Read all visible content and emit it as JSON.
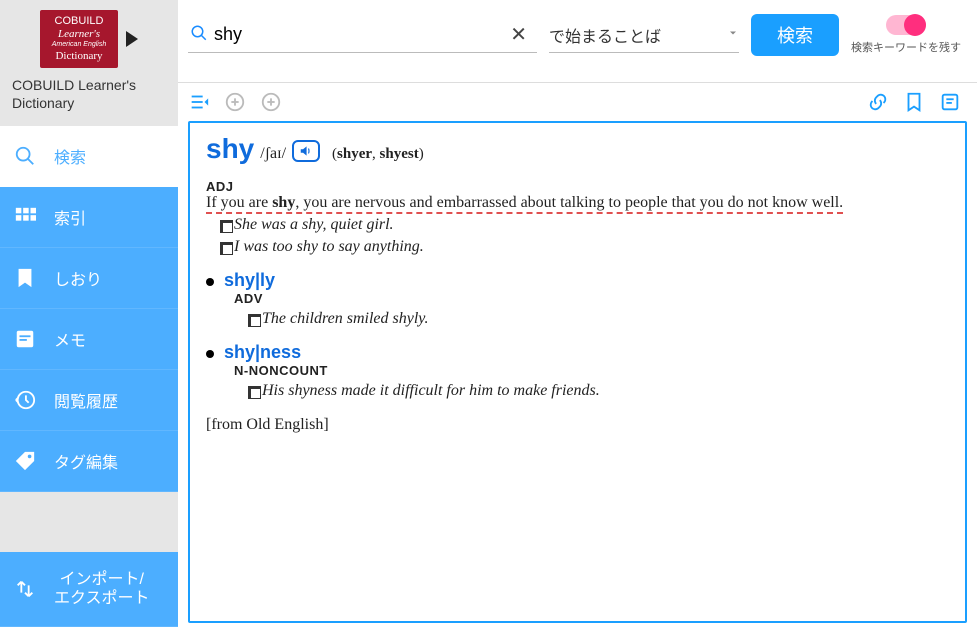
{
  "app": {
    "title_line1": "COBUILD Learner's",
    "title_line2": "Dictionary"
  },
  "logo": {
    "l1": "COBUILD",
    "l2": "Learner's",
    "l3": "American English",
    "l4": "Dictionary"
  },
  "nav": {
    "search": "検索",
    "index": "索引",
    "bookmark": "しおり",
    "memo": "メモ",
    "history": "閲覧履歴",
    "tag": "タグ編集",
    "import_line1": "インポート/",
    "import_line2": "エクスポート"
  },
  "search": {
    "value": "shy",
    "filter": "で始まることば",
    "button": "検索",
    "toggle_label": "検索キーワードを残す"
  },
  "entry": {
    "headword": "shy",
    "ipa": "/ʃaɪ/",
    "forms_open": "(",
    "form1": "shyer",
    "form_sep": ", ",
    "form2": "shyest",
    "forms_close": ")",
    "pos": "ADJ",
    "def_pre": "If you are ",
    "def_bold": "shy",
    "def_post": ", you are nervous and embarrassed about talking to people that you do not know well.",
    "ex1": "She was a shy, quiet girl.",
    "ex2": "I was too shy to say anything.",
    "deriv1": {
      "head": "shy|ly",
      "pos": "ADV",
      "ex": "The children smiled shyly."
    },
    "deriv2": {
      "head": "shy|ness",
      "pos": "N-NONCOUNT",
      "ex": "His shyness made it difficult for him to make friends."
    },
    "etym": "[from Old English]"
  }
}
